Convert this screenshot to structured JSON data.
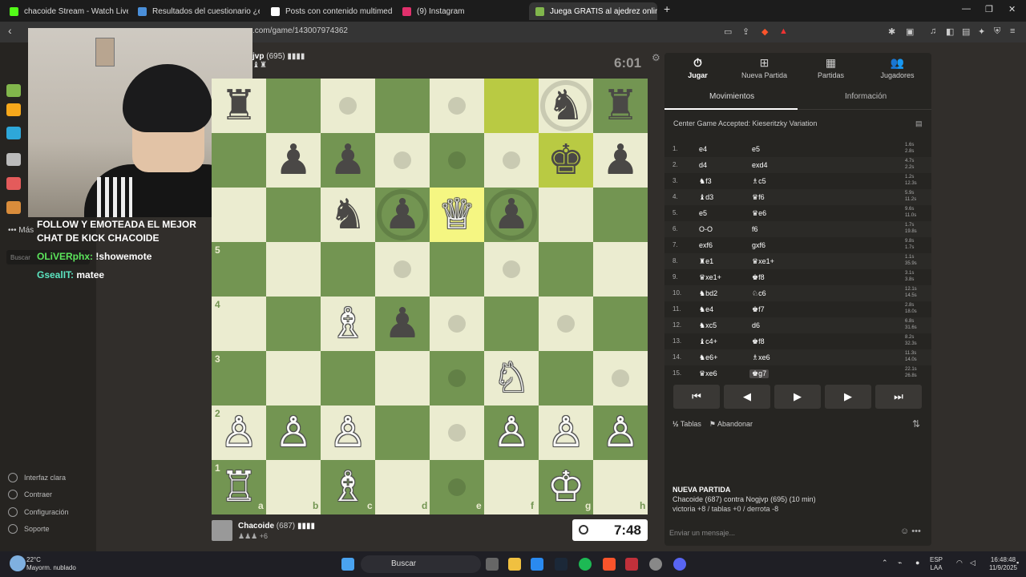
{
  "browser": {
    "tabs": [
      {
        "title": "chacoide Stream - Watch Live on",
        "color": "#53fc18"
      },
      {
        "title": "Resultados del cuestionario ¿eres un",
        "color": "#4a8fd9"
      },
      {
        "title": "Posts con contenido multimedia de",
        "color": "#ffffff"
      },
      {
        "title": "(9) Instagram",
        "color": "#e1306c"
      },
      {
        "title": "Juega GRATIS al ajedrez online -",
        "color": "#81b64c"
      }
    ],
    "close_glyph": "✕",
    "new_tab_glyph": "+",
    "url": ".com/game/143007974362"
  },
  "sidebar": {
    "more_label": "Más",
    "search_placeholder": "Buscar",
    "footer": [
      "Interfaz clara",
      "Contraer",
      "Configuración",
      "Soporte"
    ],
    "partial_text": "Ch"
  },
  "stream_chat": {
    "banner_line1": "FOLLOW  Y EMOTEADA  EL MEJOR",
    "banner_line2": "CHAT DE KICK  CHACOIDE",
    "messages": [
      {
        "user": "OLiVERphx:",
        "text": "!showemote",
        "color": "#5ce65c"
      },
      {
        "user": "GsealIT:",
        "text": "matee",
        "color": "#5ce6c2"
      }
    ]
  },
  "opponent": {
    "name": "jvp",
    "rating": "(695)",
    "bars": "▮▮▮▮",
    "captured": "♝♜",
    "clock": "6:01"
  },
  "board": {
    "squares": [
      {
        "r": 0,
        "c": 0,
        "p": "♜",
        "col": "b"
      },
      {
        "r": 0,
        "c": 2,
        "p": "",
        "dot": true
      },
      {
        "r": 0,
        "c": 4,
        "p": "",
        "dot": true
      },
      {
        "r": 0,
        "c": 5,
        "p": "",
        "hl": "hl2"
      },
      {
        "r": 0,
        "c": 6,
        "p": "♞",
        "col": "b",
        "ring": true
      },
      {
        "r": 0,
        "c": 7,
        "p": "♜",
        "col": "b"
      },
      {
        "r": 1,
        "c": 1,
        "p": "♟",
        "col": "b"
      },
      {
        "r": 1,
        "c": 2,
        "p": "♟",
        "col": "b"
      },
      {
        "r": 1,
        "c": 3,
        "p": "",
        "dot": true
      },
      {
        "r": 1,
        "c": 4,
        "p": "",
        "dot": true
      },
      {
        "r": 1,
        "c": 5,
        "p": "",
        "dot": true
      },
      {
        "r": 1,
        "c": 6,
        "p": "♚",
        "col": "b",
        "hl": "hl2"
      },
      {
        "r": 1,
        "c": 7,
        "p": "♟",
        "col": "b"
      },
      {
        "r": 2,
        "c": 2,
        "p": "♞",
        "col": "b"
      },
      {
        "r": 2,
        "c": 3,
        "p": "♟",
        "col": "b",
        "ring": true
      },
      {
        "r": 2,
        "c": 4,
        "p": "♕",
        "col": "w",
        "hl": "hl"
      },
      {
        "r": 2,
        "c": 5,
        "p": "♟",
        "col": "b",
        "ring": true
      },
      {
        "r": 3,
        "c": 3,
        "p": "",
        "dot": true
      },
      {
        "r": 3,
        "c": 5,
        "p": "",
        "dot": true
      },
      {
        "r": 4,
        "c": 2,
        "p": "♗",
        "col": "w"
      },
      {
        "r": 4,
        "c": 3,
        "p": "♟",
        "col": "b"
      },
      {
        "r": 4,
        "c": 4,
        "p": "",
        "dot": true
      },
      {
        "r": 4,
        "c": 6,
        "p": "",
        "dot": true
      },
      {
        "r": 5,
        "c": 4,
        "p": "",
        "dot": true
      },
      {
        "r": 5,
        "c": 5,
        "p": "♘",
        "col": "w"
      },
      {
        "r": 5,
        "c": 7,
        "p": "",
        "dot": true
      },
      {
        "r": 6,
        "c": 0,
        "p": "♙",
        "col": "w"
      },
      {
        "r": 6,
        "c": 1,
        "p": "♙",
        "col": "w"
      },
      {
        "r": 6,
        "c": 2,
        "p": "♙",
        "col": "w"
      },
      {
        "r": 6,
        "c": 4,
        "p": "",
        "dot": true
      },
      {
        "r": 6,
        "c": 5,
        "p": "♙",
        "col": "w"
      },
      {
        "r": 6,
        "c": 6,
        "p": "♙",
        "col": "w"
      },
      {
        "r": 6,
        "c": 7,
        "p": "♙",
        "col": "w"
      },
      {
        "r": 7,
        "c": 0,
        "p": "♖",
        "col": "w"
      },
      {
        "r": 7,
        "c": 2,
        "p": "♗",
        "col": "w"
      },
      {
        "r": 7,
        "c": 4,
        "p": "",
        "dot": true
      },
      {
        "r": 7,
        "c": 6,
        "p": "♔",
        "col": "w"
      }
    ],
    "files": [
      "a",
      "b",
      "c",
      "d",
      "e",
      "f",
      "g",
      "h"
    ],
    "ranks": [
      "5",
      "4",
      "3",
      "2",
      "1"
    ]
  },
  "player": {
    "name": "Chacoide",
    "rating": "(687)",
    "bars": "▮▮▮▮",
    "captured": "♟♟♟",
    "advantage": "+6",
    "clock": "7:48"
  },
  "panel": {
    "tabs": [
      {
        "icon": "⏱",
        "label": "Jugar"
      },
      {
        "icon": "⊞",
        "label": "Nueva Partida"
      },
      {
        "icon": "▦",
        "label": "Partidas"
      },
      {
        "icon": "👥",
        "label": "Jugadores"
      }
    ],
    "subtabs": [
      "Movimientos",
      "Información"
    ],
    "opening": "Center Game Accepted: Kieseritzky Variation",
    "moves": [
      {
        "n": "1.",
        "w": "e4",
        "b": "e5",
        "tw": "1.6s",
        "tb": "2.8s"
      },
      {
        "n": "2.",
        "w": "d4",
        "b": "exd4",
        "tw": "4.7s",
        "tb": "2.2s"
      },
      {
        "n": "3.",
        "w": "♞f3",
        "b": "♗c5",
        "tw": "1.2s",
        "tb": "12.3s"
      },
      {
        "n": "4.",
        "w": "♝d3",
        "b": "♛f6",
        "tw": "5.9s",
        "tb": "11.2s"
      },
      {
        "n": "5.",
        "w": "e5",
        "b": "♛e6",
        "tw": "9.6s",
        "tb": "11.0s"
      },
      {
        "n": "6.",
        "w": "O-O",
        "b": "f6",
        "tw": "1.7s",
        "tb": "19.8s"
      },
      {
        "n": "7.",
        "w": "exf6",
        "b": "gxf6",
        "tw": "9.8s",
        "tb": "1.7s"
      },
      {
        "n": "8.",
        "w": "♜e1",
        "b": "♛xe1+",
        "tw": "1.1s",
        "tb": "35.9s"
      },
      {
        "n": "9.",
        "w": "♛xe1+",
        "b": "♚f8",
        "tw": "3.1s",
        "tb": "3.8s"
      },
      {
        "n": "10.",
        "w": "♞bd2",
        "b": "♘c6",
        "tw": "12.1s",
        "tb": "14.5s"
      },
      {
        "n": "11.",
        "w": "♞e4",
        "b": "♚f7",
        "tw": "2.8s",
        "tb": "18.0s"
      },
      {
        "n": "12.",
        "w": "♞xc5",
        "b": "d6",
        "tw": "6.8s",
        "tb": "31.6s"
      },
      {
        "n": "13.",
        "w": "♝c4+",
        "b": "♚f8",
        "tw": "8.2s",
        "tb": "32.3s"
      },
      {
        "n": "14.",
        "w": "♞e6+",
        "b": "♗xe6",
        "tw": "11.3s",
        "tb": "14.0s"
      },
      {
        "n": "15.",
        "w": "♛xe6",
        "b": "♚g7",
        "tw": "22.1s",
        "tb": "26.8s"
      }
    ],
    "nav": [
      "⏮",
      "◀",
      "▶",
      "▶",
      "⏭"
    ],
    "draw": "Tablas",
    "resign": "Abandonar",
    "new_game_title": "NUEVA PARTIDA",
    "new_game_line1": "Chacoide (687) contra Nogjvp (695) (10 min)",
    "new_game_line2": "victoria +8 / tablas +0 / derrota -8",
    "message_placeholder": "Enviar un mensaje..."
  },
  "taskbar": {
    "weather_temp": "22°C",
    "weather_desc": "Mayorm. nublado",
    "search": "Buscar",
    "lang1": "ESP",
    "lang2": "LAA",
    "time": "16:48:48",
    "date": "11/9/2025"
  }
}
